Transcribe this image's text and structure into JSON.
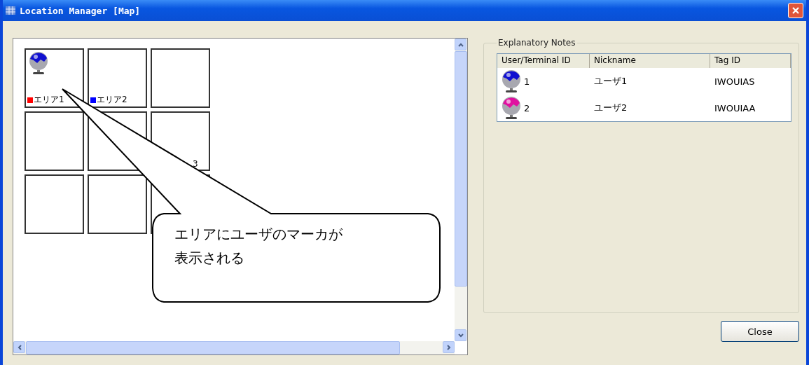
{
  "window": {
    "title": "Location Manager [Map]"
  },
  "map": {
    "cells": [
      {
        "label": "エリア1",
        "color": "#ff0000",
        "marker": true
      },
      {
        "label": "エリア2",
        "color": "#0000ff",
        "marker": false
      },
      {
        "marker": false
      },
      {
        "marker": false
      },
      {
        "marker": false
      },
      {
        "label": "3",
        "marker": false
      },
      {
        "marker": false
      },
      {
        "marker": false
      },
      {
        "marker": false
      }
    ],
    "callout": {
      "text": "エリアにユーザのマーカが表示される"
    }
  },
  "notes": {
    "title": "Explanatory Notes",
    "columns": [
      "User/Terminal ID",
      "Nickname",
      "Tag ID"
    ],
    "rows": [
      {
        "id": "1",
        "nickname": "ユーザ1",
        "tag_id": "IWOUIAS",
        "color": "#1010d0"
      },
      {
        "id": "2",
        "nickname": "ユーザ2",
        "tag_id": "IWOUIAA",
        "color": "#e010a0"
      }
    ]
  },
  "buttons": [
    "Close"
  ]
}
